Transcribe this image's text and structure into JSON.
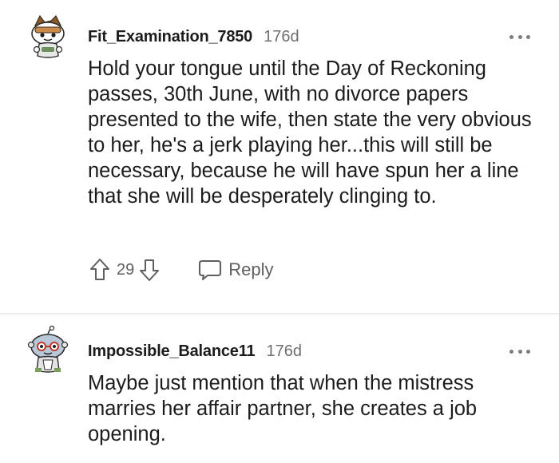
{
  "comments": [
    {
      "username": "Fit_Examination_7850",
      "age": "176d",
      "body": "Hold your tongue until the Day of Reckoning passes, 30th June, with no divorce papers presented to the wife, then state the very obvious to her, he's a jerk playing her...this will still be necessary, because he will have spun her a line that she will be desperately clinging to.",
      "score": "29",
      "reply_label": "Reply",
      "avatar_icon": "snoo-avatar-icon"
    },
    {
      "username": "Impossible_Balance11",
      "age": "176d",
      "body": "Maybe just mention that when the mistress marries her affair partner, she creates a job opening.",
      "avatar_icon": "snoo-avatar-icon"
    }
  ],
  "colors": {
    "text": "#1c1c1c",
    "muted": "#6f6f6f",
    "icon": "#5f5f5f",
    "divider": "#ececec"
  }
}
